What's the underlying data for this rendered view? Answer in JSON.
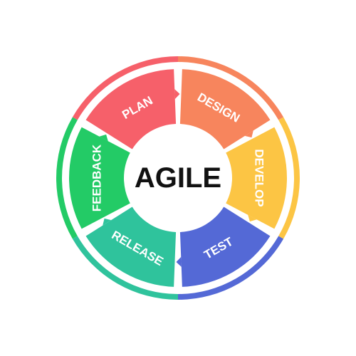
{
  "center_label": "AGILE",
  "stages": [
    {
      "label": "PLAN",
      "color": "#f6606a"
    },
    {
      "label": "DESIGN",
      "color": "#f7855d"
    },
    {
      "label": "DEVELOP",
      "color": "#fcc544"
    },
    {
      "label": "TEST",
      "color": "#5469d6"
    },
    {
      "label": "RELEASE",
      "color": "#2fc39c"
    },
    {
      "label": "FEEDBACK",
      "color": "#23cb66"
    }
  ]
}
